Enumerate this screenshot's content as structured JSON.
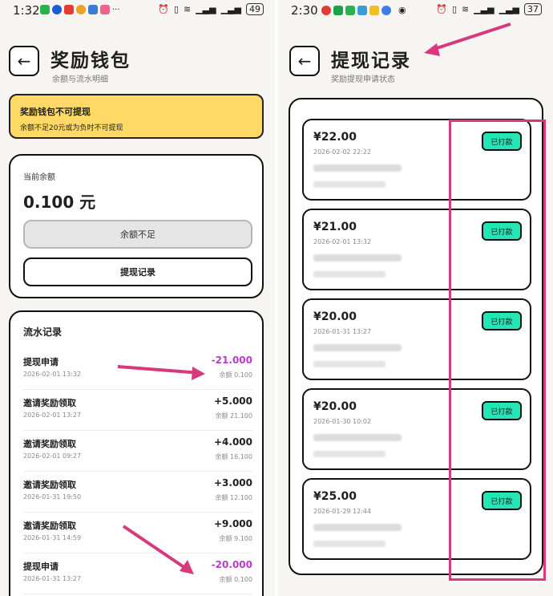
{
  "left": {
    "status": {
      "time": "1:32",
      "battery": "49"
    },
    "title": "奖励钱包",
    "subtitle": "余额与流水明细",
    "warning": {
      "title": "奖励钱包不可提现",
      "text": "余额不足20元或为负时不可提现"
    },
    "balance": {
      "label": "当前余额",
      "amount": "0.100 元",
      "insufficient_label": "余额不足",
      "records_label": "提现记录"
    },
    "ledger": {
      "title": "流水记录",
      "rows": [
        {
          "title": "提现申请",
          "date": "2026-02-01 13:32",
          "amount": "-21.000",
          "balance": "余额 0.100",
          "negative": true
        },
        {
          "title": "邀请奖励领取",
          "date": "2026-02-01 13:27",
          "amount": "+5.000",
          "balance": "余额 21.100",
          "negative": false
        },
        {
          "title": "邀请奖励领取",
          "date": "2026-02-01 09:27",
          "amount": "+4.000",
          "balance": "余额 16.100",
          "negative": false
        },
        {
          "title": "邀请奖励领取",
          "date": "2026-01-31 19:50",
          "amount": "+3.000",
          "balance": "余额 12.100",
          "negative": false
        },
        {
          "title": "邀请奖励领取",
          "date": "2026-01-31 14:59",
          "amount": "+9.000",
          "balance": "余额 9.100",
          "negative": false
        },
        {
          "title": "提现申请",
          "date": "2026-01-31 13:27",
          "amount": "-20.000",
          "balance": "余额 0.100",
          "negative": true
        }
      ]
    }
  },
  "right": {
    "status": {
      "time": "2:30",
      "battery": "37"
    },
    "title": "提现记录",
    "subtitle": "奖励提现申请状态",
    "records": [
      {
        "amount": "¥22.00",
        "date": "2026-02-02 22:22",
        "status": "已打款"
      },
      {
        "amount": "¥21.00",
        "date": "2026-02-01 13:32",
        "status": "已打款"
      },
      {
        "amount": "¥20.00",
        "date": "2026-01-31 13:27",
        "status": "已打款"
      },
      {
        "amount": "¥20.00",
        "date": "2026-01-30 10:02",
        "status": "已打款"
      },
      {
        "amount": "¥25.00",
        "date": "2026-01-29 12:44",
        "status": "已打款"
      }
    ]
  },
  "colors": {
    "warning_bg": "#ffd966",
    "badge_bg": "#24e6b5",
    "negative": "#b73cc9",
    "annotation": "#d63a7c"
  },
  "icons": [
    "back-arrow-icon",
    "wifi-icon",
    "signal-icon",
    "alarm-icon",
    "vibrate-icon",
    "battery-icon",
    "eye-icon"
  ]
}
